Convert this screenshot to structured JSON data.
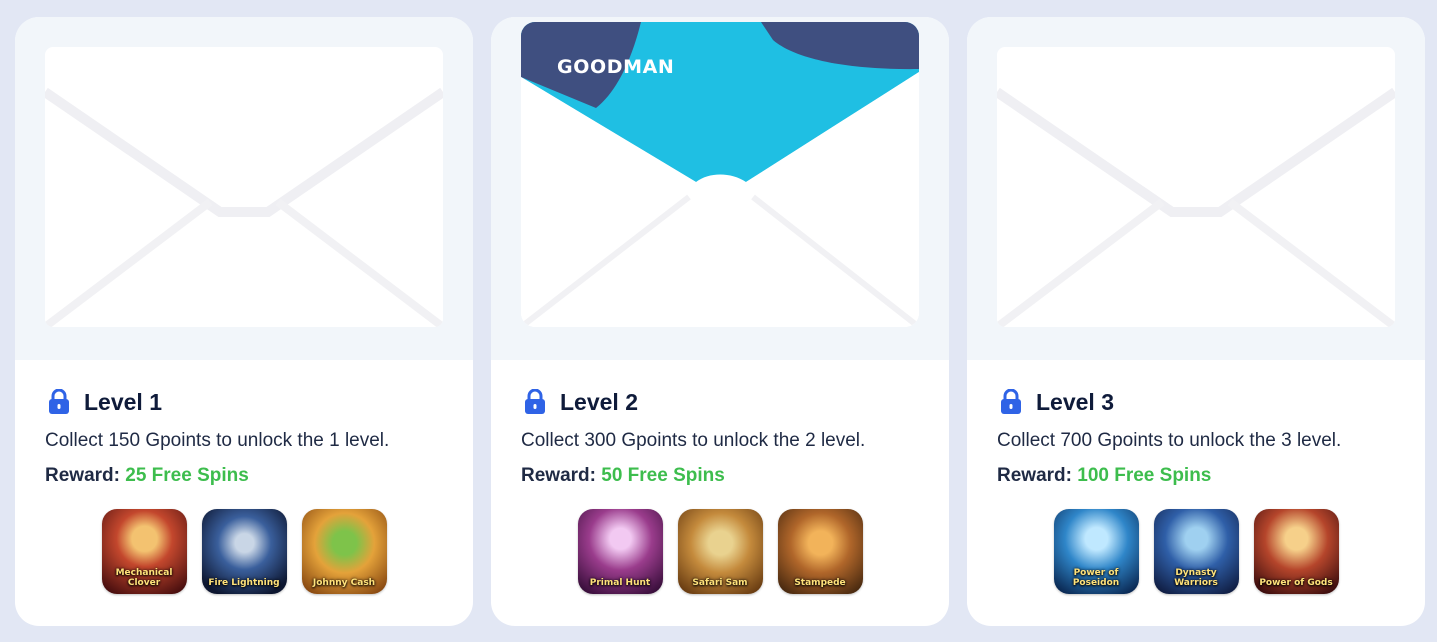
{
  "brand": "GOODMAN",
  "reward_label": "Reward:",
  "levels": [
    {
      "title": "Level 1",
      "description": "Collect 150 Gpoints to unlock the 1 level.",
      "reward": "25 Free Spins",
      "locked": true,
      "games": [
        "Mechanical Clover",
        "Fire Lightning",
        "Johnny Cash"
      ]
    },
    {
      "title": "Level 2",
      "description": "Collect 300 Gpoints to unlock the 2 level.",
      "reward": "50 Free Spins",
      "locked": true,
      "games": [
        "Primal Hunt",
        "Safari Sam",
        "Stampede"
      ]
    },
    {
      "title": "Level 3",
      "description": "Collect 700 Gpoints to unlock the 3 level.",
      "reward": "100 Free Spins",
      "locked": true,
      "games": [
        "Power of Poseidon",
        "Dynasty Warriors",
        "Power of Gods"
      ]
    }
  ],
  "colors": {
    "background": "#e2e7f4",
    "reward_green": "#3dbd4d",
    "lock_blue": "#2f63e6",
    "brand_navy": "#3f4f80",
    "brand_cyan": "#1fbfe3"
  }
}
